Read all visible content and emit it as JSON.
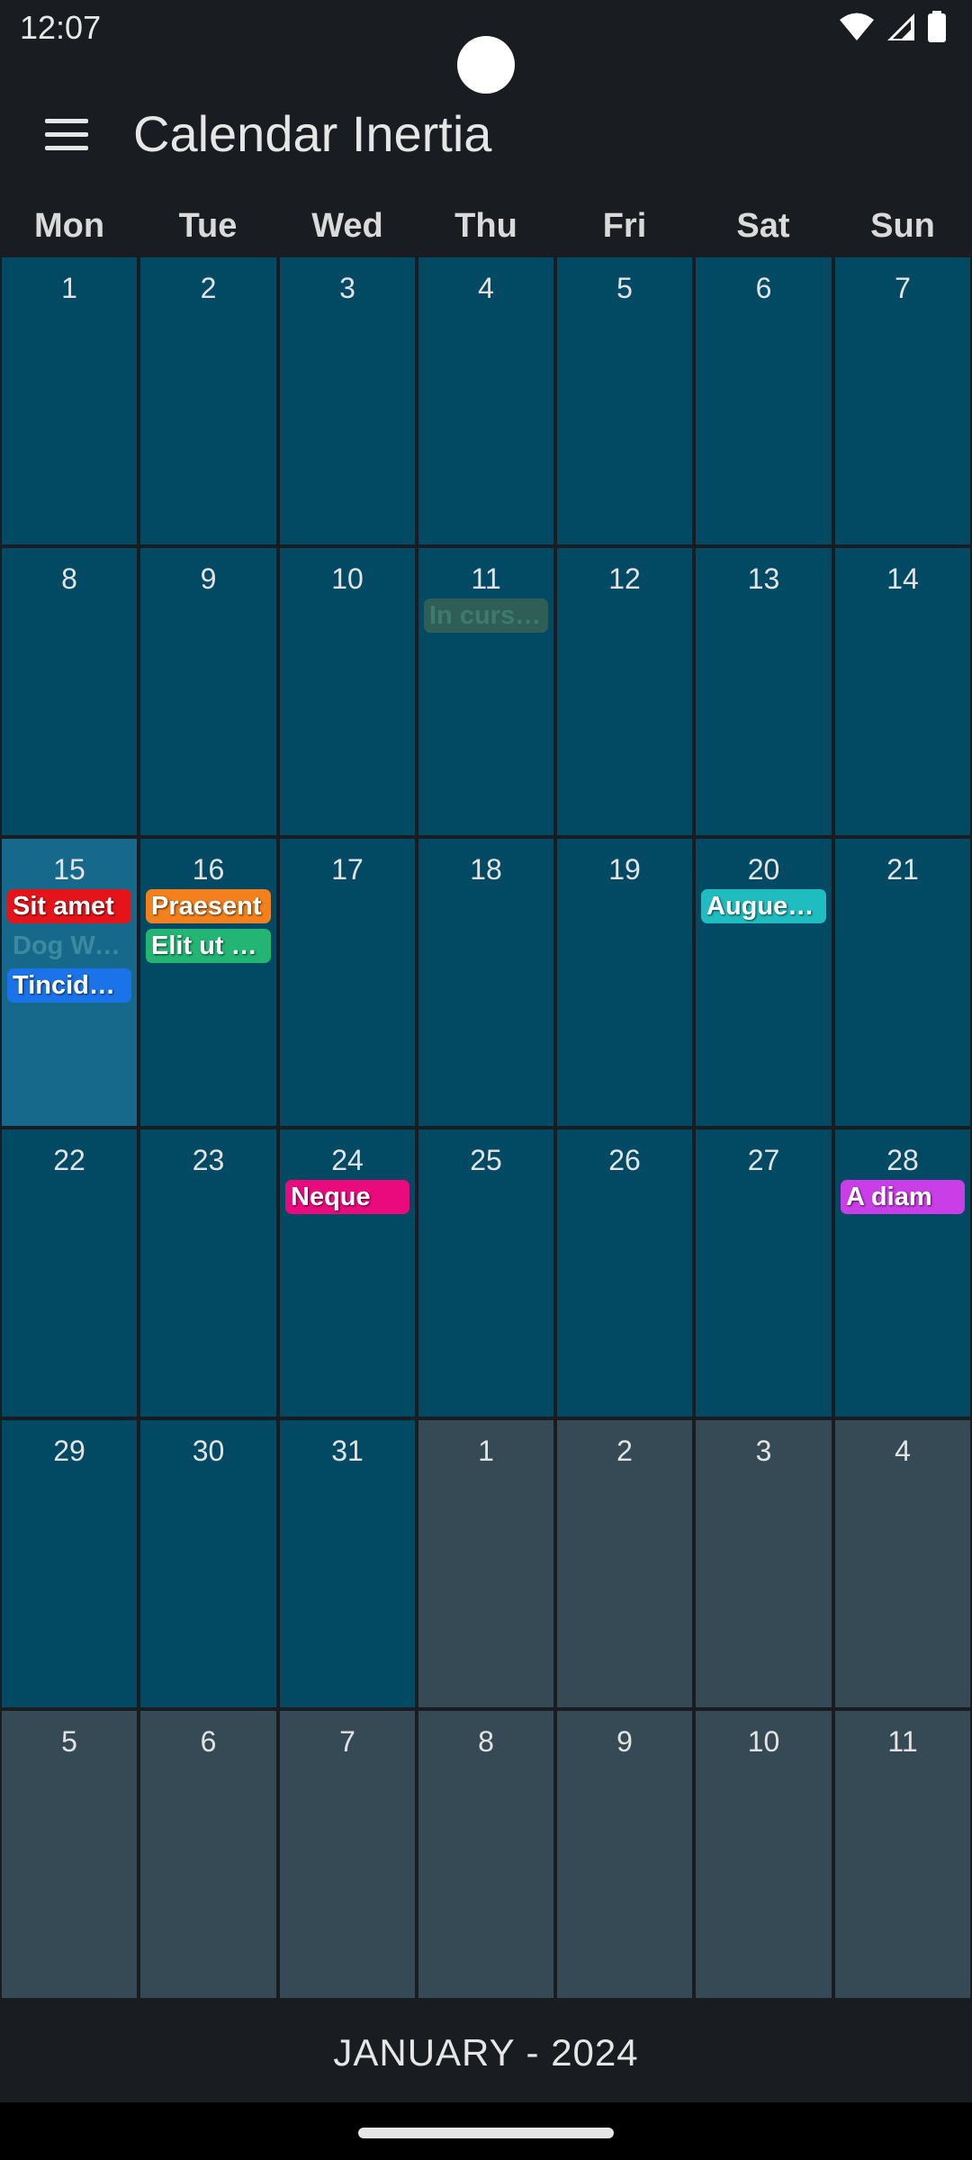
{
  "status_bar": {
    "time": "12:07",
    "icons": [
      "wifi-icon",
      "cellular-signal-icon",
      "battery-icon"
    ]
  },
  "app_bar": {
    "menu_icon": "hamburger-menu-icon",
    "title": "Calendar Inertia"
  },
  "weekdays": [
    "Mon",
    "Tue",
    "Wed",
    "Thu",
    "Fri",
    "Sat",
    "Sun"
  ],
  "colors": {
    "current_month_cell": "#024a63",
    "selected_cell": "#16698b",
    "other_month_cell": "#364a55",
    "background": "#191c20"
  },
  "weeks": [
    [
      {
        "day": "1",
        "type": "cur"
      },
      {
        "day": "2",
        "type": "cur"
      },
      {
        "day": "3",
        "type": "cur"
      },
      {
        "day": "4",
        "type": "cur"
      },
      {
        "day": "5",
        "type": "cur"
      },
      {
        "day": "6",
        "type": "cur"
      },
      {
        "day": "7",
        "type": "cur"
      }
    ],
    [
      {
        "day": "8",
        "type": "cur"
      },
      {
        "day": "9",
        "type": "cur"
      },
      {
        "day": "10",
        "type": "cur"
      },
      {
        "day": "11",
        "type": "cur",
        "events": [
          {
            "title": "In cursus",
            "color": "#2e5e55",
            "text_color": "#3f7a6c",
            "faded": true
          }
        ]
      },
      {
        "day": "12",
        "type": "cur"
      },
      {
        "day": "13",
        "type": "cur"
      },
      {
        "day": "14",
        "type": "cur"
      }
    ],
    [
      {
        "day": "15",
        "type": "sel",
        "events": [
          {
            "title": "Sit amet",
            "color": "#e4141a",
            "text_color": "#ffffff"
          },
          {
            "title": "Dog Walk",
            "color": "#16698b",
            "text_color": "#3b8aa0",
            "faded": true
          },
          {
            "title": "Tincidunt",
            "color": "#1a73e8",
            "text_color": "#ffffff"
          }
        ]
      },
      {
        "day": "16",
        "type": "cur",
        "events": [
          {
            "title": "Praesent",
            "color": "#f2811d",
            "text_color": "#ffffff"
          },
          {
            "title": "Elit ut aliquam",
            "color": "#22b573",
            "text_color": "#ffffff"
          }
        ]
      },
      {
        "day": "17",
        "type": "cur"
      },
      {
        "day": "18",
        "type": "cur"
      },
      {
        "day": "19",
        "type": "cur"
      },
      {
        "day": "20",
        "type": "cur",
        "events": [
          {
            "title": "Augue lacus",
            "color": "#1fbcc0",
            "text_color": "#ffffff"
          }
        ]
      },
      {
        "day": "21",
        "type": "cur"
      }
    ],
    [
      {
        "day": "22",
        "type": "cur"
      },
      {
        "day": "23",
        "type": "cur"
      },
      {
        "day": "24",
        "type": "cur",
        "events": [
          {
            "title": "Neque",
            "color": "#ea0a7e",
            "text_color": "#ffffff"
          }
        ]
      },
      {
        "day": "25",
        "type": "cur"
      },
      {
        "day": "26",
        "type": "cur"
      },
      {
        "day": "27",
        "type": "cur"
      },
      {
        "day": "28",
        "type": "cur",
        "events": [
          {
            "title": "A diam",
            "color": "#c93ee6",
            "text_color": "#ffffff"
          }
        ]
      }
    ],
    [
      {
        "day": "29",
        "type": "cur"
      },
      {
        "day": "30",
        "type": "cur"
      },
      {
        "day": "31",
        "type": "cur"
      },
      {
        "day": "1",
        "type": "oth"
      },
      {
        "day": "2",
        "type": "oth"
      },
      {
        "day": "3",
        "type": "oth"
      },
      {
        "day": "4",
        "type": "oth"
      }
    ],
    [
      {
        "day": "5",
        "type": "oth"
      },
      {
        "day": "6",
        "type": "oth"
      },
      {
        "day": "7",
        "type": "oth"
      },
      {
        "day": "8",
        "type": "oth"
      },
      {
        "day": "9",
        "type": "oth"
      },
      {
        "day": "10",
        "type": "oth"
      },
      {
        "day": "11",
        "type": "oth"
      }
    ]
  ],
  "footer": {
    "month_label": "JANUARY - 2024"
  }
}
